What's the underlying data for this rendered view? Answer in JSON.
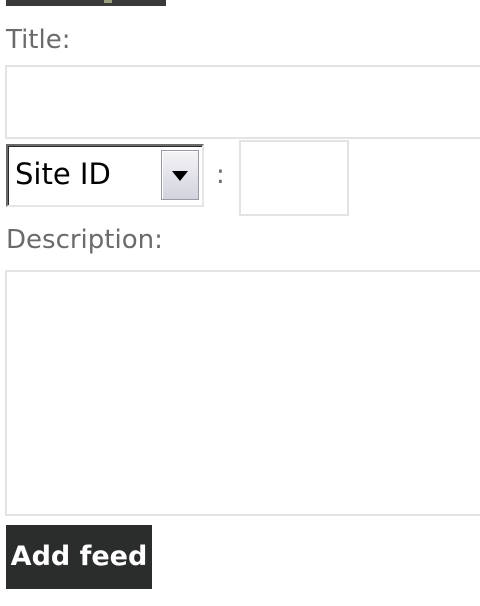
{
  "form": {
    "title_label": "Title:",
    "title_value": "",
    "id_select": {
      "selected": "Site ID"
    },
    "separator": ":",
    "id_value": "",
    "description_label": "Description:",
    "description_value": "",
    "submit_label": "Add feed"
  },
  "icons": {
    "dropdown": "chevron-down-icon"
  },
  "colors": {
    "label_text": "#6b6b6b",
    "field_border": "#e3e3e3",
    "button_bg": "#2a2d2b",
    "button_text": "#ffffff"
  }
}
